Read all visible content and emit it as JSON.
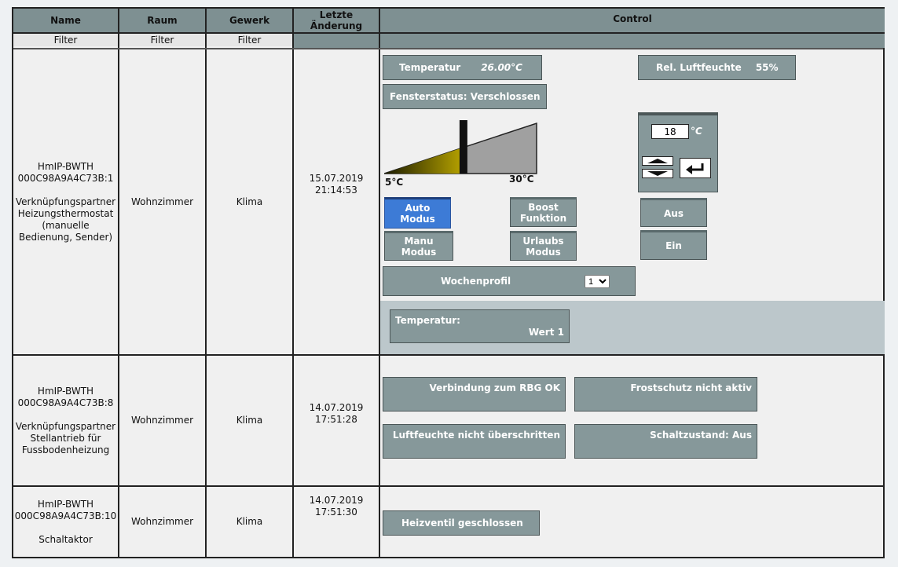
{
  "headers": {
    "name": "Name",
    "room": "Raum",
    "trade": "Gewerk",
    "last_change_line1": "Letzte",
    "last_change_line2": "Änderung",
    "control": "Control"
  },
  "filters": {
    "name": "Filter",
    "room": "Filter",
    "trade": "Filter"
  },
  "rows": [
    {
      "device": "HmIP-BWTH",
      "address": "000C98A9A4C73B:1",
      "desc_1": "Verknüpfungspartner",
      "desc_2": "Heizungsthermostat",
      "desc_3": "(manuelle",
      "desc_4": "Bedienung, Sender)",
      "room": "Wohnzimmer",
      "trade": "Klima",
      "date": "15.07.2019",
      "time": "21:14:53"
    },
    {
      "device": "HmIP-BWTH",
      "address": "000C98A9A4C73B:8",
      "desc_1": "Verknüpfungspartner",
      "desc_2": "Stellantrieb für",
      "desc_3": "Fussbodenheizung",
      "room": "Wohnzimmer",
      "trade": "Klima",
      "date": "14.07.2019",
      "time": "17:51:28"
    },
    {
      "device": "HmIP-BWTH",
      "address": "000C98A9A4C73B:10",
      "desc_1": "Schaltaktor",
      "room": "Wohnzimmer",
      "trade": "Klima",
      "date": "14.07.2019",
      "time": "17:51:30"
    }
  ],
  "thermostat": {
    "temp_label": "Temperatur",
    "temp_value": "26.00°C",
    "humidity_label": "Rel. Luftfeuchte",
    "humidity_value": "55%",
    "window_status": "Fensterstatus: Verschlossen",
    "slider_min": "5°C",
    "slider_max": "30°C",
    "slider_fraction": 0.52,
    "setpoint": "18",
    "setpoint_unit": "°C",
    "auto_l1": "Auto",
    "auto_l2": "Modus",
    "boost_l1": "Boost",
    "boost_l2": "Funktion",
    "off_label": "Aus",
    "manu_l1": "Manu",
    "manu_l2": "Modus",
    "vacation_l1": "Urlaubs",
    "vacation_l2": "Modus",
    "on_label": "Ein",
    "weekprofile_label": "Wochenprofil",
    "weekprofile_value": "1",
    "temp_sensor_label": "Temperatur:",
    "temp_sensor_value": "Wert 1"
  },
  "actuator": {
    "rbg": "Verbindung zum RBG OK",
    "frost": "Frostschutz nicht aktiv",
    "humidity": "Luftfeuchte nicht überschritten",
    "switch_state": "Schaltzustand: Aus"
  },
  "switch": {
    "valve": "Heizventil geschlossen"
  },
  "colors": {
    "header": "#7e9092",
    "button": "#86989a",
    "active_button": "#3d7bd6",
    "slider_fill": "#b8a400"
  }
}
